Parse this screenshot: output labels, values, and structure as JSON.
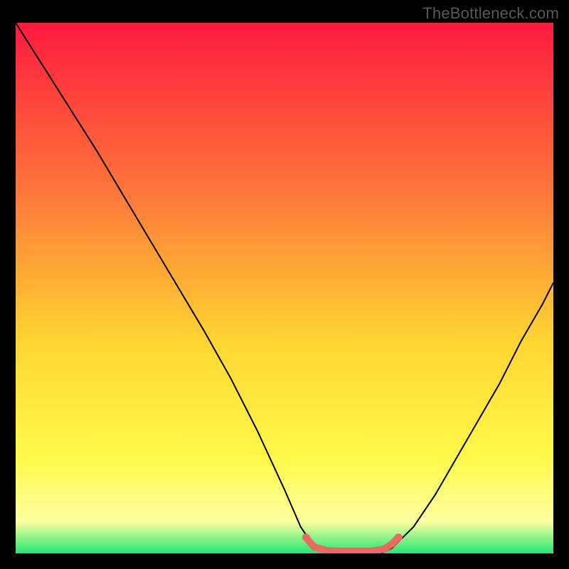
{
  "watermark": "TheBottleneck.com",
  "chart_data": {
    "type": "line",
    "title": "",
    "xlabel": "",
    "ylabel": "",
    "xlim": [
      0,
      100
    ],
    "ylim": [
      0,
      100
    ],
    "grid": false,
    "legend": false,
    "background_gradient": {
      "top": "#ff1a3e",
      "mid_upper": "#ff7a3a",
      "mid": "#ffd531",
      "mid_lower": "#fff94a",
      "base_yellow": "#fdff9e",
      "green": "#1fe874"
    },
    "series": [
      {
        "name": "bottleneck-curve",
        "stroke": "#000000",
        "stroke_width": 2,
        "x": [
          0,
          5,
          10,
          15,
          20,
          25,
          30,
          35,
          40,
          45,
          50,
          53,
          55,
          58,
          60,
          64,
          68,
          70,
          74,
          78,
          82,
          86,
          90,
          94,
          98,
          100
        ],
        "values": [
          100,
          92,
          84,
          76,
          67.5,
          59,
          50.5,
          42,
          33,
          23,
          12,
          5,
          2,
          0.5,
          0,
          0,
          0,
          1,
          5,
          11,
          18,
          25,
          32,
          40,
          47,
          51
        ]
      }
    ],
    "highlight_segment": {
      "name": "optimal-range",
      "color": "#e96a63",
      "points": [
        {
          "x": 54.0,
          "y": 3.0
        },
        {
          "x": 55.5,
          "y": 1.2
        },
        {
          "x": 58.0,
          "y": 0.5
        },
        {
          "x": 60.0,
          "y": 0.4
        },
        {
          "x": 63.0,
          "y": 0.4
        },
        {
          "x": 66.0,
          "y": 0.4
        },
        {
          "x": 68.5,
          "y": 0.8
        },
        {
          "x": 70.0,
          "y": 1.8
        },
        {
          "x": 71.2,
          "y": 3.0
        }
      ],
      "endpoint_radius": 5.5,
      "stroke_width": 10
    }
  }
}
